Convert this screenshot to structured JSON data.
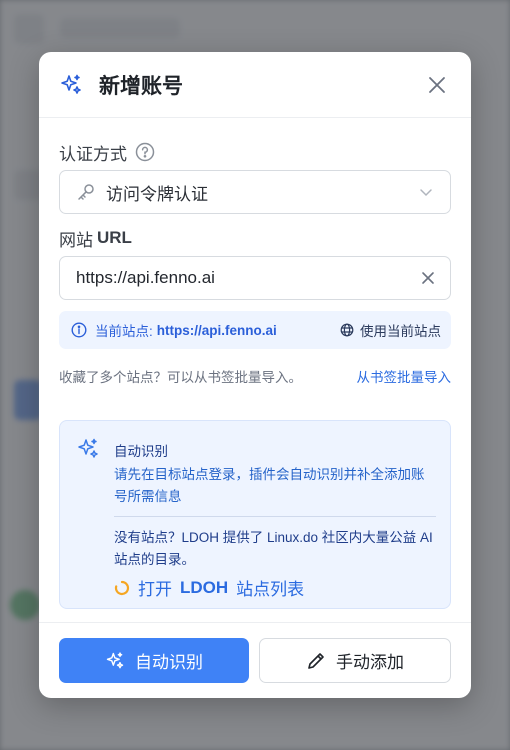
{
  "modal": {
    "title": "新增账号",
    "auth_label": "认证方式",
    "auth_value": "访问令牌认证",
    "url_label_cn": "网站",
    "url_label_en": "URL",
    "url_value": "https://api.fenno.ai",
    "current_site_label": "当前站点:",
    "current_site_url": "https://api.fenno.ai",
    "use_current_label": "使用当前站点",
    "bookmark_hint": "收藏了多个站点？可以从书签批量导入。",
    "bookmark_link": "从书签批量导入",
    "auto_title": "自动识别",
    "auto_desc": "请先在目标站点登录，插件会自动识别并补全添加账号所需信息",
    "ldoh_desc": "没有站点？LDOH 提供了 Linux.do 社区内大量公益 AI 站点的目录。",
    "ldoh_link_prefix": "打开",
    "ldoh_link_bold": "LDOH",
    "ldoh_link_suffix": "站点列表",
    "auto_button": "自动识别",
    "manual_button": "手动添加"
  },
  "colors": {
    "accent": "#3f82f6",
    "link": "#2b6be0",
    "info_bg": "#eef4ff",
    "spinner": "#f5a623"
  }
}
